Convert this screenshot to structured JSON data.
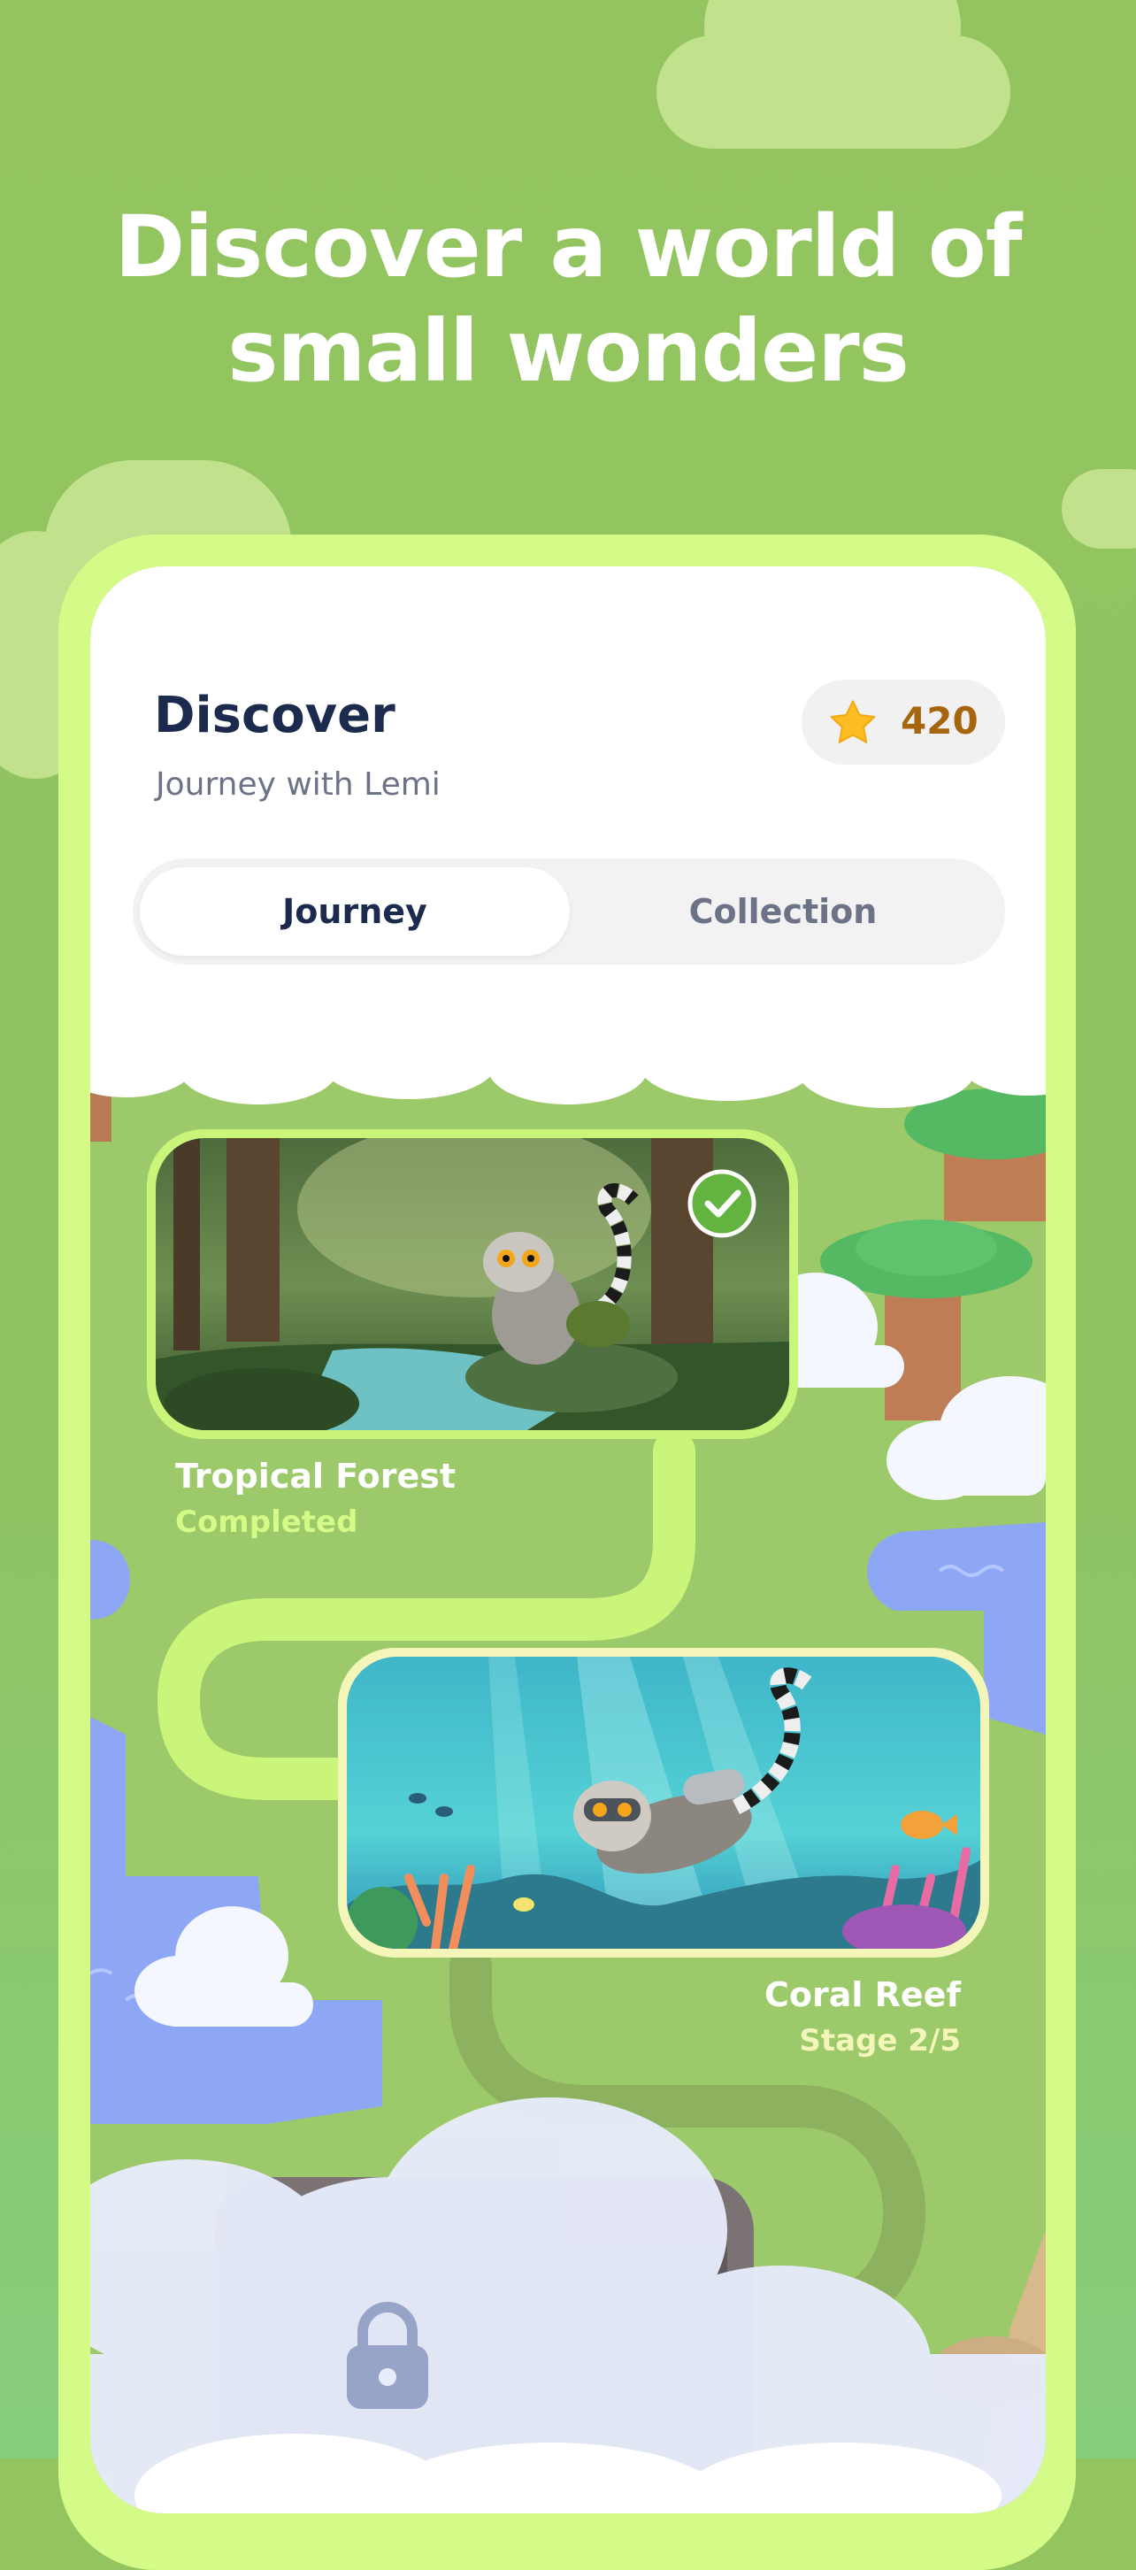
{
  "headline": {
    "line1": "Discover a world of",
    "line2": "small wonders"
  },
  "header": {
    "title": "Discover",
    "subtitle": "Journey with Lemi",
    "points": "420"
  },
  "tabs": [
    {
      "label": "Journey",
      "active": true
    },
    {
      "label": "Collection",
      "active": false
    }
  ],
  "stages": [
    {
      "name": "Tropical Forest",
      "status": "Completed",
      "scene": "lemur-forest-illustration"
    },
    {
      "name": "Coral Reef",
      "status": "Stage 2/5",
      "scene": "lemur-diving-illustration"
    },
    {
      "name": "",
      "status": "",
      "scene": "locked-stage-illustration",
      "locked": true
    }
  ],
  "colors": {
    "background": "#93c45f",
    "frame": "#d4fb88",
    "path": "#c8f57a",
    "title": "#1c2a4d",
    "points": "#a6650f",
    "completed_text": "#d4fb88"
  }
}
